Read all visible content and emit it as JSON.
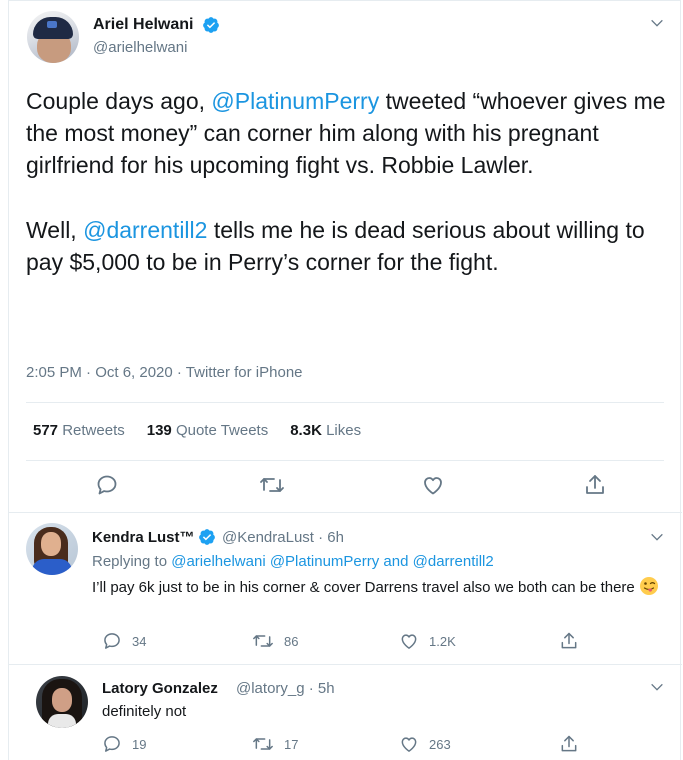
{
  "main_tweet": {
    "author_name": "Ariel Helwani",
    "author_handle": "@arielhelwani",
    "text_p1_a": "Couple days ago, ",
    "text_p1_mention": "@PlatinumPerry",
    "text_p1_b": " tweeted “whoever gives me the most money” can corner him along with his pregnant girlfriend for his upcoming fight vs. Robbie Lawler.",
    "text_p2_a": "Well, ",
    "text_p2_mention": "@darrentill2",
    "text_p2_b": " tells me he is dead serious about willing to pay $5,000 to be in Perry’s corner for the fight.",
    "meta": "2:05 PM · Oct 6, 2020 · Twitter for iPhone",
    "stats": {
      "retweets_count": "577",
      "retweets_label": "Retweets",
      "quotes_count": "139",
      "quotes_label": "Quote Tweets",
      "likes_count": "8.3K",
      "likes_label": "Likes"
    }
  },
  "replies": [
    {
      "name": "Kendra Lust™",
      "handle_time": "@KendraLust · 6h",
      "replying_prefix": "Replying to ",
      "replying_mentions": "@arielhelwani @PlatinumPerry",
      "replying_and": " and ",
      "replying_last": "@darrentill2",
      "text": "I’ll pay 6k just to be in his corner & cover Darrens travel also we both can be there",
      "emoji": "winking-face-with-tongue",
      "reply_count": "34",
      "retweet_count": "86",
      "like_count": "1.2K"
    },
    {
      "name": "Latory Gonzalez",
      "handle_time": "@latory_g · 5h",
      "text": "definitely not",
      "reply_count": "19",
      "retweet_count": "17",
      "like_count": "263"
    }
  ],
  "colors": {
    "link": "#1b95e0",
    "text": "#14171a",
    "muted": "#657786",
    "divider": "#e6ecf0",
    "verified": "#1da1f2"
  }
}
